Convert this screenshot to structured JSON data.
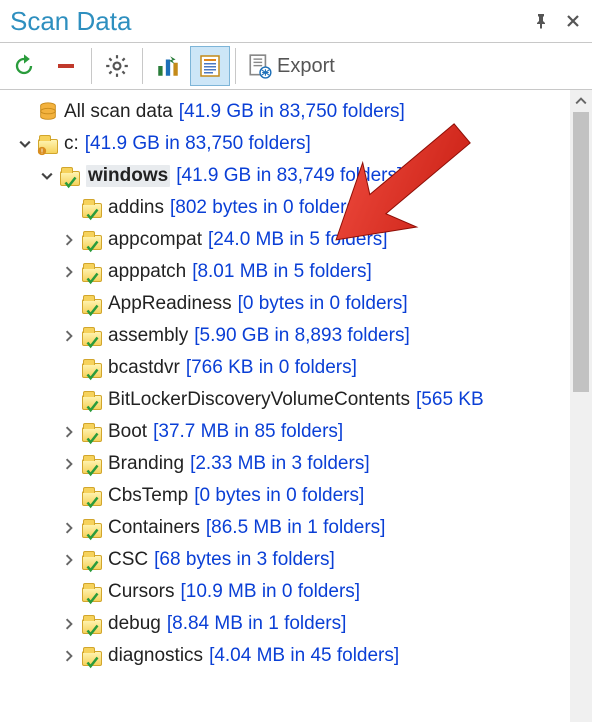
{
  "title": "Scan Data",
  "toolbar": {
    "export_label": "Export"
  },
  "root": {
    "name": "All scan data",
    "stats": "[41.9 GB in 83,750 folders]"
  },
  "drive": {
    "name": "c:",
    "stats": "[41.9 GB in 83,750 folders]",
    "expanded": true
  },
  "selected": {
    "name": "windows",
    "stats": "[41.9 GB in 83,749 folders]",
    "expanded": true
  },
  "children": [
    {
      "name": "addins",
      "stats": "[802 bytes in 0 folders]",
      "expandable": false
    },
    {
      "name": "appcompat",
      "stats": "[24.0 MB in 5 folders]",
      "expandable": true
    },
    {
      "name": "apppatch",
      "stats": "[8.01 MB in 5 folders]",
      "expandable": true
    },
    {
      "name": "AppReadiness",
      "stats": "[0 bytes in 0 folders]",
      "expandable": false
    },
    {
      "name": "assembly",
      "stats": "[5.90 GB in 8,893 folders]",
      "expandable": true
    },
    {
      "name": "bcastdvr",
      "stats": "[766 KB in 0 folders]",
      "expandable": false
    },
    {
      "name": "BitLockerDiscoveryVolumeContents",
      "stats": "[565 KB",
      "expandable": false
    },
    {
      "name": "Boot",
      "stats": "[37.7 MB in 85 folders]",
      "expandable": true
    },
    {
      "name": "Branding",
      "stats": "[2.33 MB in 3 folders]",
      "expandable": true
    },
    {
      "name": "CbsTemp",
      "stats": "[0 bytes in 0 folders]",
      "expandable": false
    },
    {
      "name": "Containers",
      "stats": "[86.5 MB in 1 folders]",
      "expandable": true
    },
    {
      "name": "CSC",
      "stats": "[68 bytes in 3 folders]",
      "expandable": true
    },
    {
      "name": "Cursors",
      "stats": "[10.9 MB in 0 folders]",
      "expandable": false
    },
    {
      "name": "debug",
      "stats": "[8.84 MB in 1 folders]",
      "expandable": true
    },
    {
      "name": "diagnostics",
      "stats": "[4.04 MB in 45 folders]",
      "expandable": true
    }
  ]
}
